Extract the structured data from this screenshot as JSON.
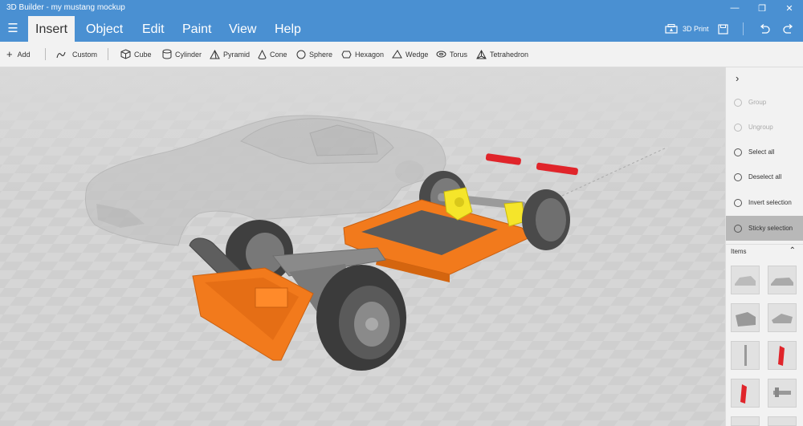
{
  "window": {
    "title": "3D Builder - my mustang mockup"
  },
  "ribbon": {
    "tabs": [
      "Insert",
      "Object",
      "Edit",
      "Paint",
      "View",
      "Help"
    ],
    "print_label": "3D Print"
  },
  "toolbar": {
    "add": "Add",
    "custom": "Custom",
    "shapes": [
      "Cube",
      "Cylinder",
      "Pyramid",
      "Cone",
      "Sphere",
      "Hexagon",
      "Wedge",
      "Torus",
      "Tetrahedron"
    ]
  },
  "sidebar": {
    "buttons": [
      {
        "label": "Group",
        "enabled": false
      },
      {
        "label": "Ungroup",
        "enabled": false
      },
      {
        "label": "Select all",
        "enabled": true
      },
      {
        "label": "Deselect all",
        "enabled": true
      },
      {
        "label": "Invert selection",
        "enabled": true
      },
      {
        "label": "Sticky selection",
        "enabled": true,
        "selected": true
      }
    ],
    "items_label": "Items"
  },
  "colors": {
    "accent": "#4a90d2",
    "chassis": "#f27a1c",
    "yellow": "#f5e52a",
    "red": "#e0242a",
    "grey": "#9a9a9a"
  }
}
